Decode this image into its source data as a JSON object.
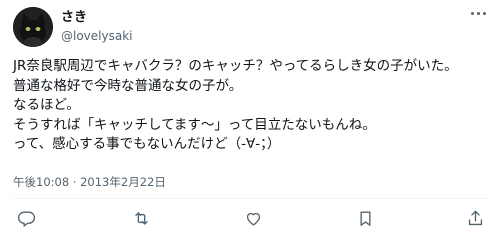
{
  "author": {
    "display_name": "さき",
    "handle": "@lovelysaki"
  },
  "tweet": {
    "lines": [
      "JR奈良駅周辺でキャバクラ？のキャッチ？やってるらしき女の子がいた。",
      "普通な格好で今時な普通な女の子が。",
      "なるほど。",
      "そうすれば「キャッチしてます〜」って目立たないもんね。",
      "って、感心する事でもないんだけど（-∀-；）"
    ],
    "timestamp": "午後10:08 · 2013年2月22日"
  },
  "actions": {
    "icons": [
      "reply-icon",
      "retweet-icon",
      "like-icon",
      "bookmark-icon",
      "share-icon"
    ]
  },
  "colors": {
    "text": "#0f1419",
    "secondary": "#536471",
    "divider": "#eff3f4"
  }
}
